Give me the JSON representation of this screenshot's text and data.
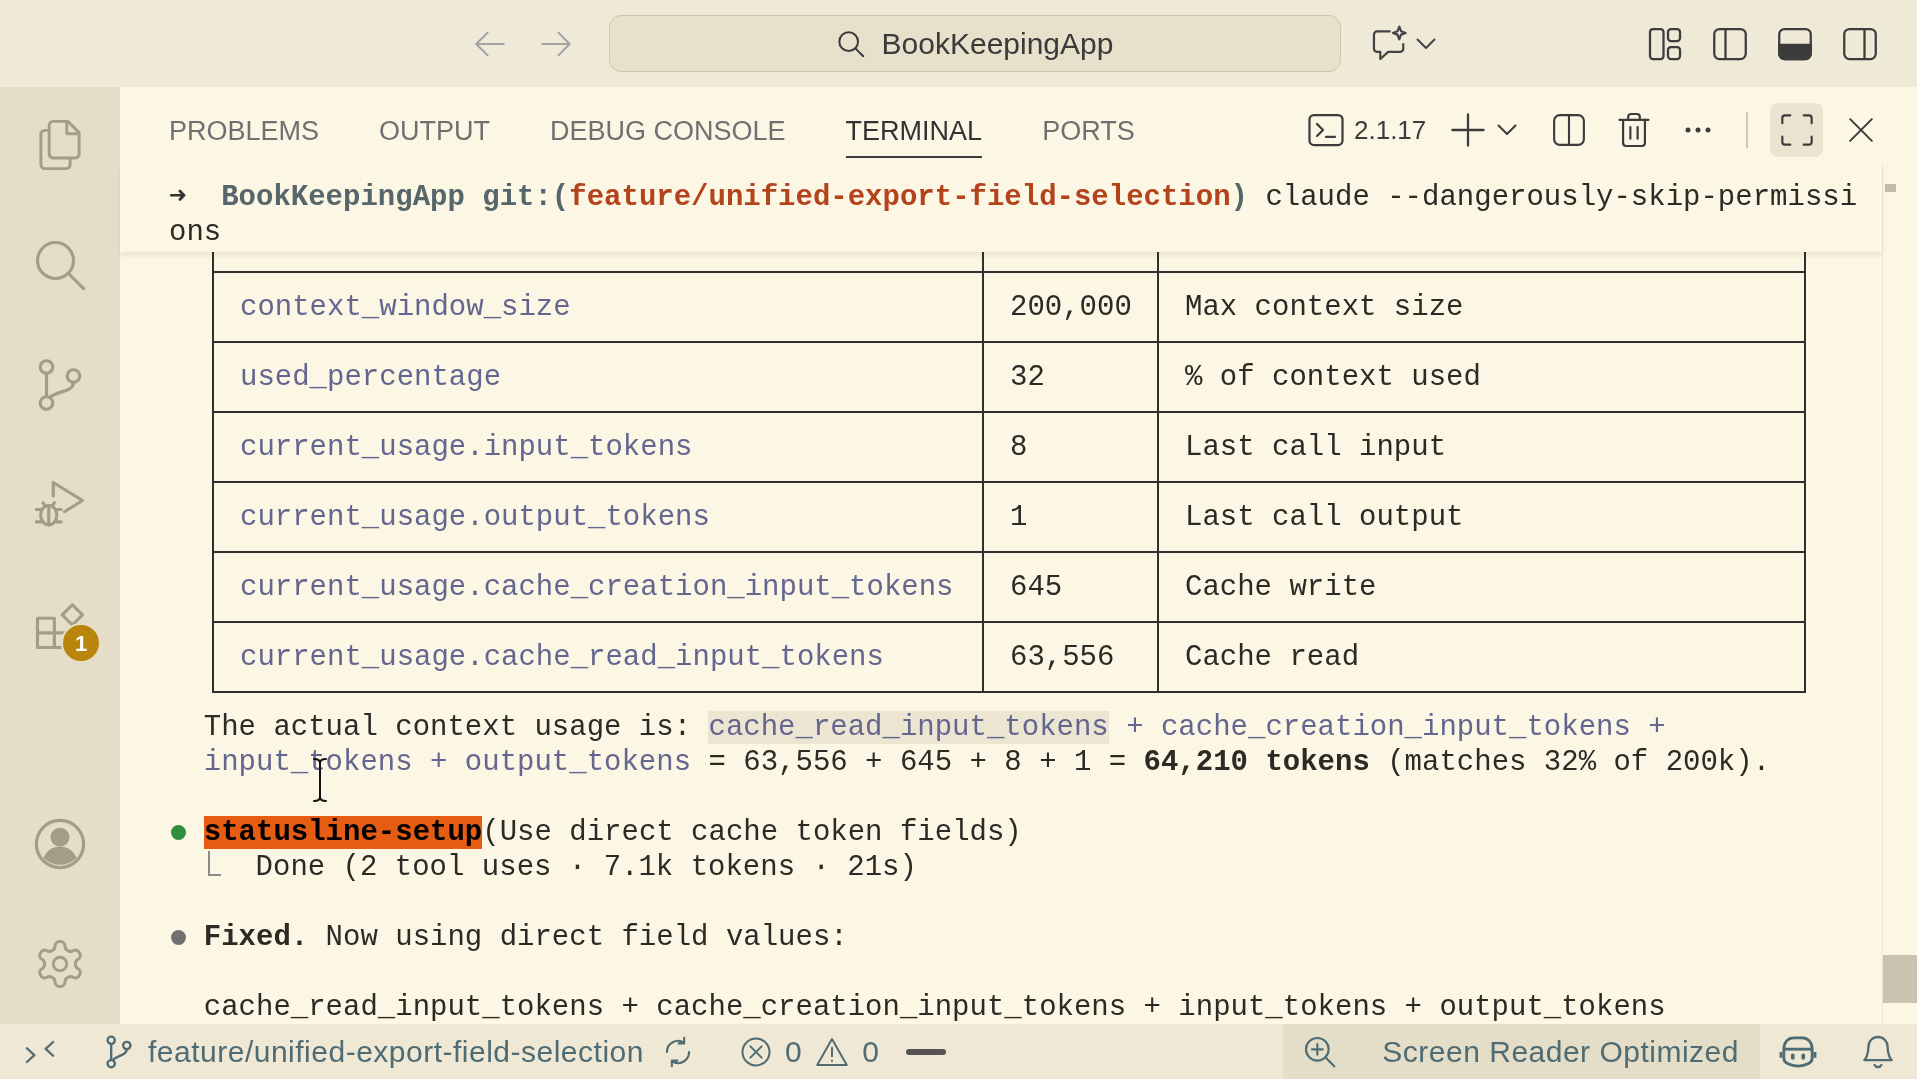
{
  "title_bar": {
    "search": "BookKeepingApp"
  },
  "activity_bar": {
    "extensions_badge": "1"
  },
  "panel": {
    "tabs": [
      {
        "label": "PROBLEMS",
        "selected": false
      },
      {
        "label": "OUTPUT",
        "selected": false
      },
      {
        "label": "DEBUG CONSOLE",
        "selected": false
      },
      {
        "label": "TERMINAL",
        "selected": true
      },
      {
        "label": "PORTS",
        "selected": false
      }
    ],
    "terminal_version": "2.1.17",
    "maximize_highlighted": true
  },
  "terminal": {
    "prompt": {
      "symbol": "➜",
      "directory": "BookKeepingApp",
      "git_open": "git:(",
      "branch": "feature/unified-export-field-selection",
      "git_close": ")",
      "command": "claude --dangerously-skip-permissions"
    },
    "table": {
      "rows": [
        [
          "context_window_size",
          "200,000",
          "Max context size"
        ],
        [
          "used_percentage",
          "32",
          "% of context used"
        ],
        [
          "current_usage.input_tokens",
          "8",
          "Last call input"
        ],
        [
          "current_usage.output_tokens",
          "1",
          "Last call output"
        ],
        [
          "current_usage.cache_creation_input_tokens",
          "645",
          "Cache write"
        ],
        [
          "current_usage.cache_read_input_tokens",
          "63,556",
          "Cache read"
        ]
      ]
    },
    "summary": [
      {
        "kind": "text",
        "text": "The actual context usage is: "
      },
      {
        "kind": "code",
        "text": "cache_read_input_tokens",
        "highlighted": true
      },
      {
        "kind": "code",
        "text": " + cache_creation_input_tokens + input_tokens + output_tokens",
        "highlighted": false
      },
      {
        "kind": "text",
        "text": " = 63,556 + 645 + 8 + 1 = "
      },
      {
        "kind": "bold",
        "text": "64,210 tokens"
      },
      {
        "kind": "text",
        "text": " (matches 32% of 200k)."
      }
    ],
    "entries": [
      {
        "kind": "task",
        "color": "#2f8f3f",
        "name": "statusline-setup",
        "description": "(Use direct cache token fields)",
        "result": "Done (2 tool uses · 7.1k tokens · 21s)"
      },
      {
        "kind": "message",
        "color": "#707070",
        "text": "**Fixed.** Now using direct field values:"
      }
    ],
    "formula": "cache_read_input_tokens + cache_creation_input_tokens + input_tokens + output_tokens"
  },
  "status_bar": {
    "branch": "feature/unified-export-field-selection",
    "errors": "0",
    "warnings": "0",
    "screen_reader": "Screen Reader Optimized"
  }
}
